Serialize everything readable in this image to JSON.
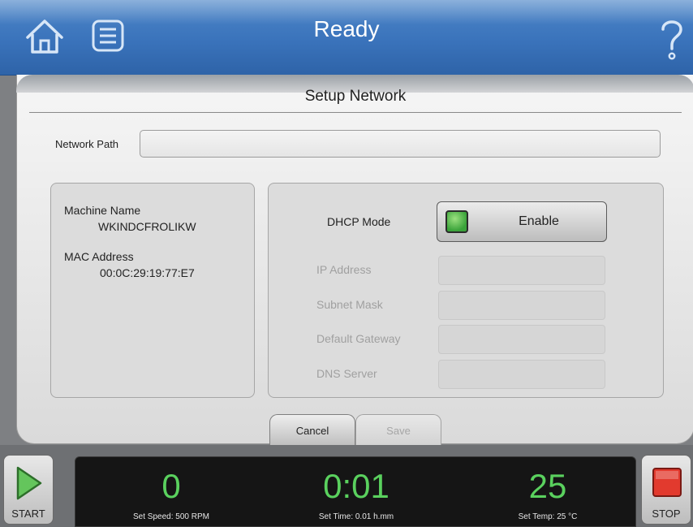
{
  "header": {
    "title": "Ready",
    "home_icon": "home-icon",
    "menu_icon": "list-menu-icon",
    "help_icon": "question-mark-icon",
    "accent_color": "#3a73bb"
  },
  "page": {
    "title": "Setup Network",
    "network_path_label": "Network Path",
    "network_path_value": ""
  },
  "machine": {
    "name_label": "Machine Name",
    "name_value": "WKINDCFROLIKW",
    "mac_label": "MAC Address",
    "mac_value": "00:0C:29:19:77:E7"
  },
  "network": {
    "dhcp_label": "DHCP Mode",
    "dhcp_button": "Enable",
    "dhcp_indicator_color": "#3aa33a",
    "fields": [
      {
        "label": "IP Address",
        "value": ""
      },
      {
        "label": "Subnet Mask",
        "value": ""
      },
      {
        "label": "Default Gateway",
        "value": ""
      },
      {
        "label": "DNS Server",
        "value": ""
      }
    ]
  },
  "actions": {
    "cancel": "Cancel",
    "save": "Save"
  },
  "status": {
    "start_label": "START",
    "stop_label": "STOP",
    "speed_value": "0",
    "speed_set": "Set Speed: 500 RPM",
    "time_value": "0:01",
    "time_set": "Set Time: 0.01 h.mm",
    "temp_value": "25",
    "temp_set": "Set Temp: 25 °C",
    "display_color": "#5ad15e"
  }
}
